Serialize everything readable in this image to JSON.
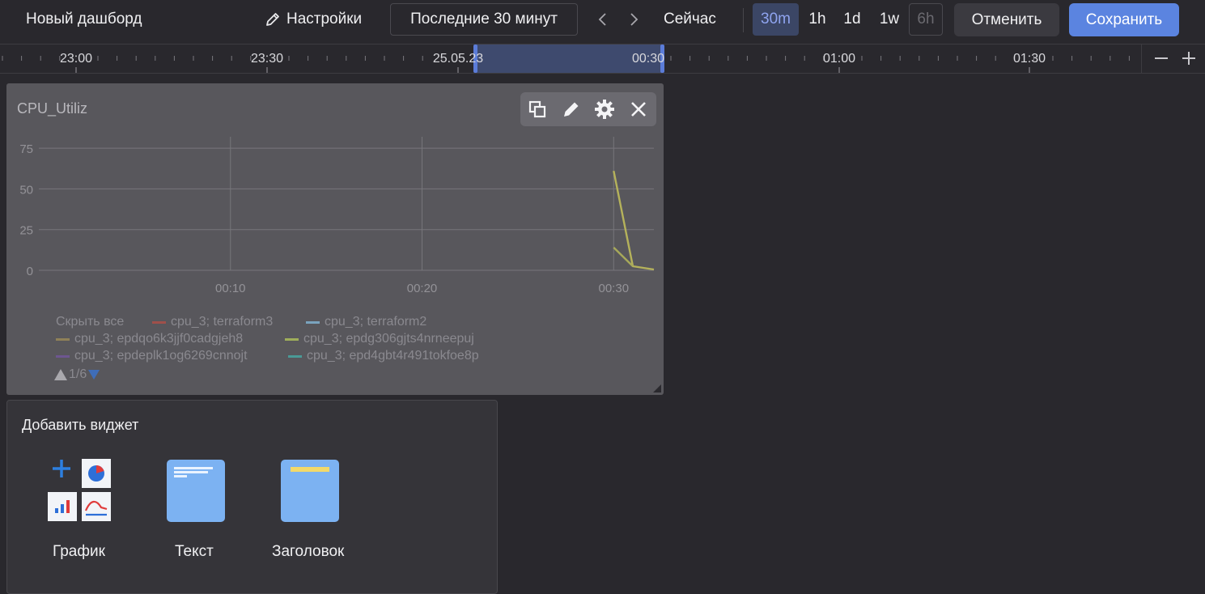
{
  "header": {
    "dashboard_title": "Новый дашборд",
    "settings_label": "Настройки",
    "time_range_label": "Последние 30 минут",
    "now_label": "Сейчас",
    "presets": [
      {
        "label": "30m",
        "state": "active"
      },
      {
        "label": "1h",
        "state": "normal"
      },
      {
        "label": "1d",
        "state": "normal"
      },
      {
        "label": "1w",
        "state": "normal"
      },
      {
        "label": "6h",
        "state": "disabled"
      }
    ],
    "cancel_label": "Отменить",
    "save_label": "Сохранить"
  },
  "timeline": {
    "labels": [
      "23:00",
      "23:30",
      "25.05.23",
      "00:30",
      "01:00",
      "01:30"
    ],
    "selection_color": "#3e4a6e",
    "handle_color": "#5b7cd8"
  },
  "widget": {
    "title": "CPU_Utiliz",
    "toolbar_icons": [
      "copy-icon",
      "edit-icon",
      "gear-icon",
      "close-icon"
    ],
    "legend": {
      "hide_all_label": "Скрыть все",
      "items": [
        {
          "label": "cpu_3; terraform3",
          "color": "#a0504a"
        },
        {
          "label": "cpu_3; terraform2",
          "color": "#7aa3be"
        },
        {
          "label": "cpu_3; epdqo6k3jjf0cadgjeh8",
          "color": "#8f8158"
        },
        {
          "label": "cpu_3; epdg306gjts4nrneepuj",
          "color": "#9fae5a"
        },
        {
          "label": "cpu_3; epdeplk1og6269cnnojt",
          "color": "#6d5690"
        },
        {
          "label": "cpu_3; epd4gbt4r491tokfoe8p",
          "color": "#4a9a97"
        }
      ],
      "page": "1/6"
    }
  },
  "chart_data": {
    "type": "line",
    "title": "CPU_Utiliz",
    "xlabel": "",
    "ylabel": "",
    "yticks": [
      0,
      25,
      50,
      75
    ],
    "xtick_labels": [
      "00:10",
      "00:20",
      "00:30"
    ],
    "xtick_minutes": [
      10,
      20,
      30
    ],
    "xlim_minutes": [
      0,
      32.1
    ],
    "ylim": [
      0,
      80
    ],
    "grid": true,
    "legend_position": "bottom",
    "series": [
      {
        "name": "cpu_3; epdqo6k3jjf0cadgjeh8",
        "color": "#b5b25b",
        "x_minutes": [
          30,
          31,
          32.1
        ],
        "values": [
          61,
          2.5,
          0.5
        ]
      },
      {
        "name": "cpu_3; epdg306gjts4nrneepuj",
        "color": "#a7a95a",
        "x_minutes": [
          30,
          31
        ],
        "values": [
          14,
          2.5
        ]
      }
    ]
  },
  "add_widget": {
    "title": "Добавить виджет",
    "items": [
      {
        "label": "График",
        "icon": "chart-widget-icon"
      },
      {
        "label": "Текст",
        "icon": "text-widget-icon"
      },
      {
        "label": "Заголовок",
        "icon": "header-widget-icon"
      }
    ]
  }
}
